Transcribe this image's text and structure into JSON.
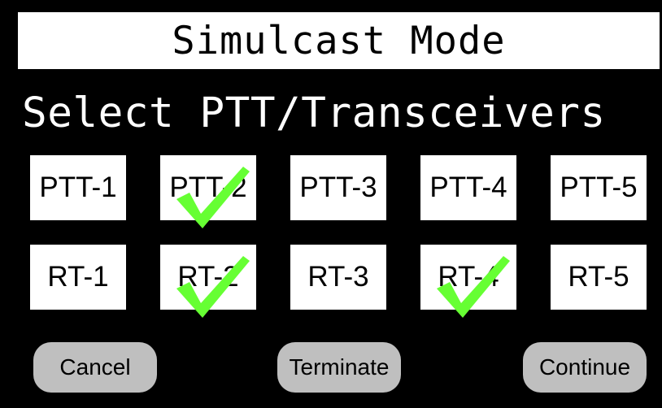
{
  "title": "Simulcast Mode",
  "subtitle": "Select PTT/Transceivers",
  "ptt": [
    {
      "label": "PTT-1",
      "checked": false
    },
    {
      "label": "PTT-2",
      "checked": true
    },
    {
      "label": "PTT-3",
      "checked": false
    },
    {
      "label": "PTT-4",
      "checked": false
    },
    {
      "label": "PTT-5",
      "checked": false
    }
  ],
  "rt": [
    {
      "label": "RT-1",
      "checked": false
    },
    {
      "label": "RT-2",
      "checked": true
    },
    {
      "label": "RT-3",
      "checked": false
    },
    {
      "label": "RT-4",
      "checked": true
    },
    {
      "label": "RT-5",
      "checked": false
    }
  ],
  "buttons": {
    "cancel": "Cancel",
    "terminate": "Terminate",
    "continue": "Continue"
  },
  "colors": {
    "background": "#000000",
    "tile": "#ffffff",
    "button": "#bfbfbf",
    "check": "#66ff33"
  }
}
